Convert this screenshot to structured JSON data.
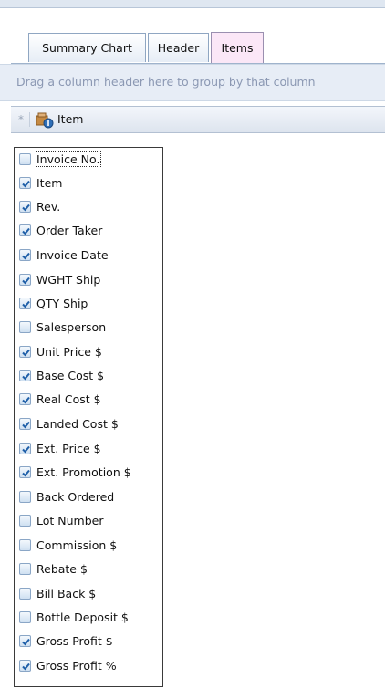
{
  "tabs": [
    {
      "label": "Summary Chart",
      "active": false
    },
    {
      "label": "Header",
      "active": false
    },
    {
      "label": "Items",
      "active": true
    }
  ],
  "group_panel": {
    "text": "Drag a column header here to group by that column"
  },
  "column_header": {
    "marker": "*",
    "label": "Item",
    "icon": "item-column-icon"
  },
  "column_chooser": {
    "items": [
      {
        "label": "Invoice No.",
        "checked": false,
        "focused": true
      },
      {
        "label": "Item",
        "checked": true
      },
      {
        "label": "Rev.",
        "checked": true
      },
      {
        "label": "Order Taker",
        "checked": true
      },
      {
        "label": "Invoice Date",
        "checked": true
      },
      {
        "label": "WGHT Ship",
        "checked": true
      },
      {
        "label": "QTY Ship",
        "checked": true
      },
      {
        "label": "Salesperson",
        "checked": false
      },
      {
        "label": "Unit Price $",
        "checked": true
      },
      {
        "label": "Base Cost $",
        "checked": true
      },
      {
        "label": "Real Cost $",
        "checked": true
      },
      {
        "label": "Landed Cost $",
        "checked": true
      },
      {
        "label": "Ext. Price $",
        "checked": true
      },
      {
        "label": "Ext. Promotion $",
        "checked": true
      },
      {
        "label": "Back Ordered",
        "checked": false
      },
      {
        "label": "Lot Number",
        "checked": false
      },
      {
        "label": "Commission $",
        "checked": false
      },
      {
        "label": "Rebate $",
        "checked": false
      },
      {
        "label": "Bill Back $",
        "checked": false
      },
      {
        "label": "Bottle Deposit $",
        "checked": false
      },
      {
        "label": "Gross Profit $",
        "checked": true
      },
      {
        "label": "Gross Profit %",
        "checked": true
      }
    ]
  },
  "colors": {
    "accent_tab": "#fbe7f7",
    "panel": "#e7edf6",
    "check": "#1f5fa8"
  }
}
